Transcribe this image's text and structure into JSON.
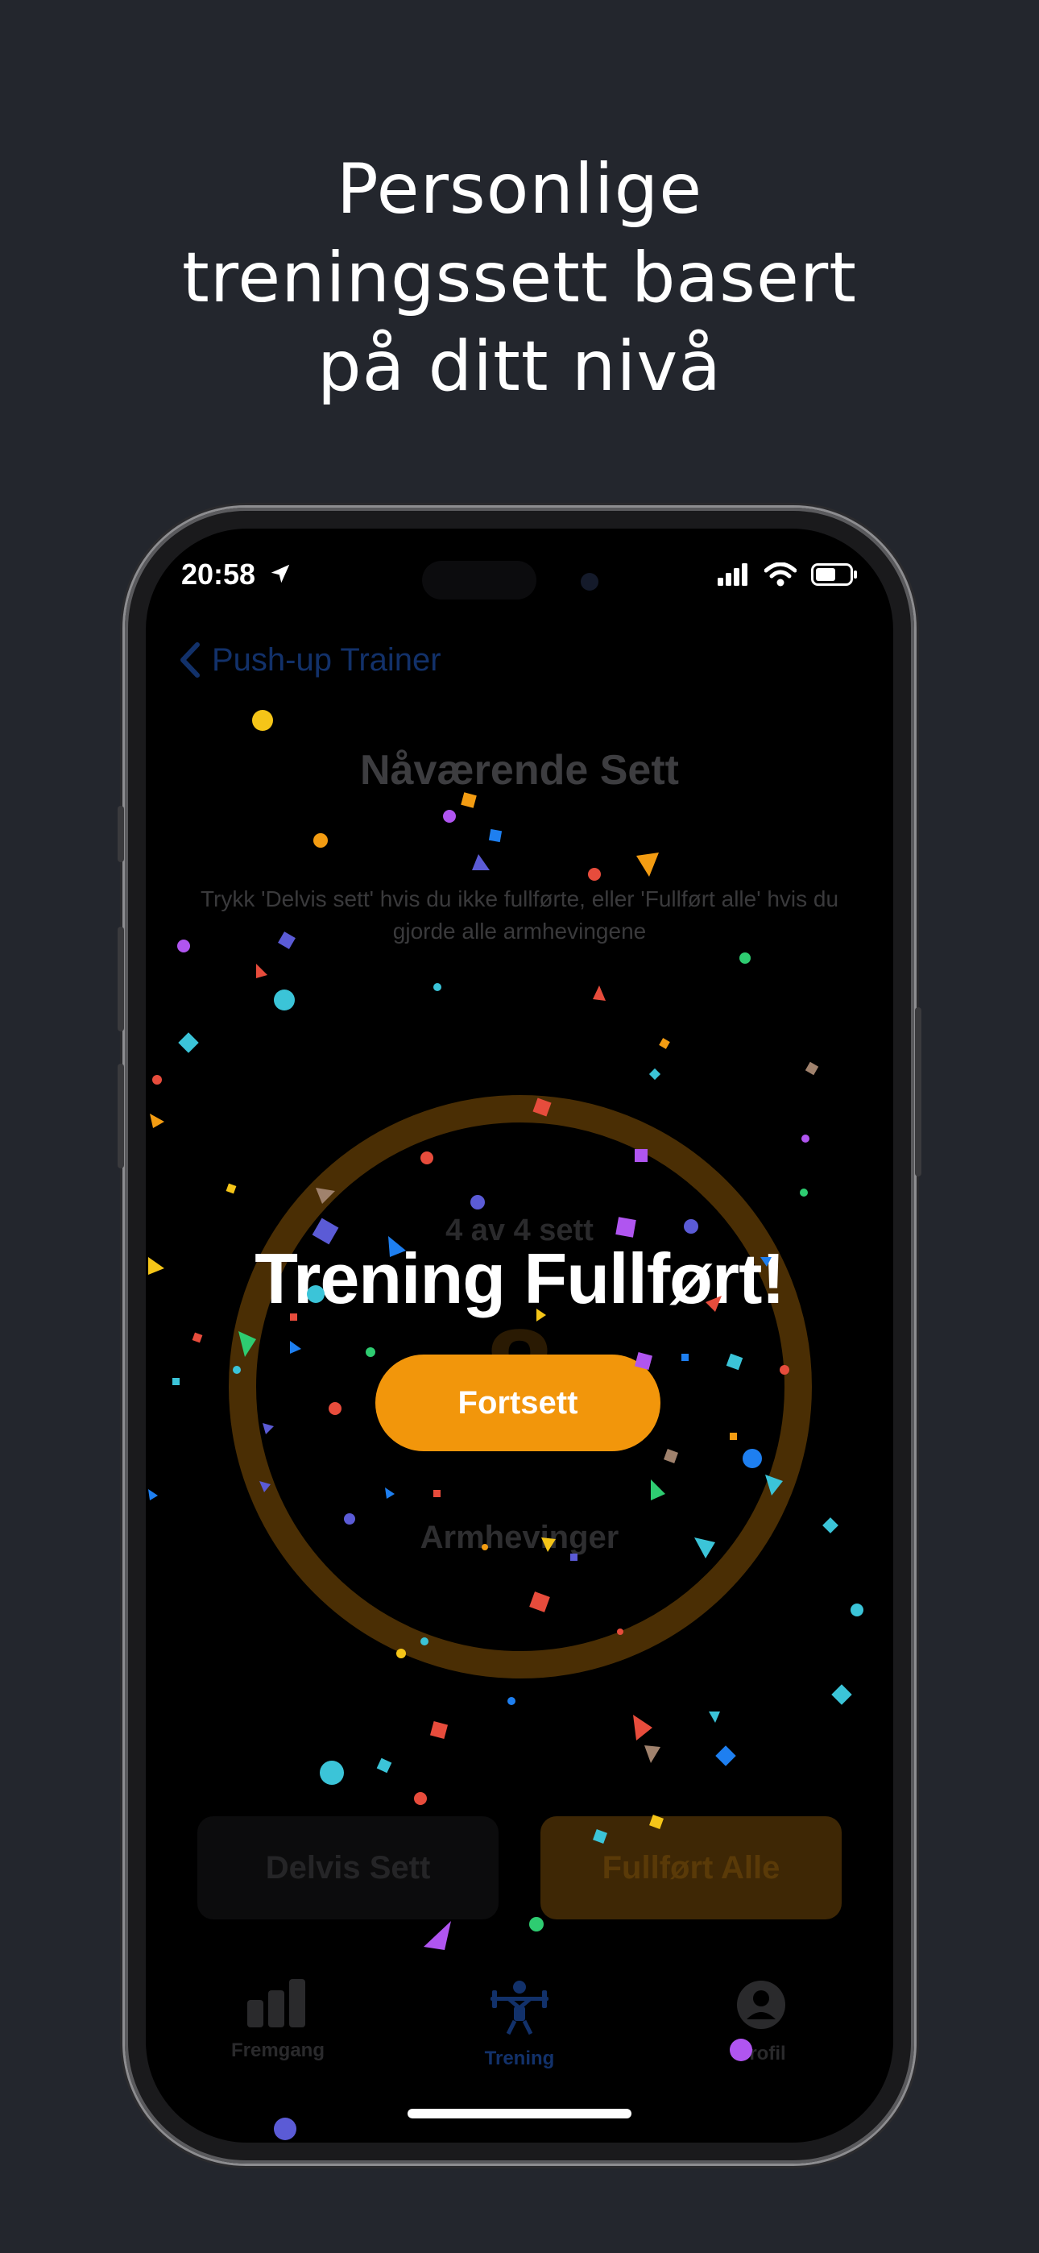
{
  "headline": {
    "line1": "Personlige",
    "line2": "treningssett basert",
    "line3": "på ditt nivå"
  },
  "status_bar": {
    "time": "20:58",
    "icons": [
      "location-arrow-icon",
      "cellular-signal-icon",
      "wifi-icon",
      "battery-icon"
    ]
  },
  "nav": {
    "back_label": "Push-up Trainer"
  },
  "screen": {
    "title": "Nåværende Sett",
    "subtitle": "Trykk 'Delvis sett' hvis du ikke fullførte, eller 'Fullført alle' hvis du gjorde alle armhevingene",
    "set_progress": "4 av 4 sett",
    "rep_count": "8",
    "rep_label": "Armhevinger"
  },
  "overlay": {
    "title": "Trening Fullført!",
    "continue_label": "Fortsett"
  },
  "actions": {
    "partial_label": "Delvis Sett",
    "all_label": "Fullført Alle"
  },
  "tabs": [
    {
      "label": "Fremgang",
      "icon": "bar-chart-icon",
      "active": false
    },
    {
      "label": "Trening",
      "icon": "weightlifter-icon",
      "active": true
    },
    {
      "label": "Profil",
      "icon": "person-icon",
      "active": false
    }
  ],
  "colors": {
    "accent": "#F2960B",
    "background": "#23262D",
    "active_tab": "#12316A"
  }
}
